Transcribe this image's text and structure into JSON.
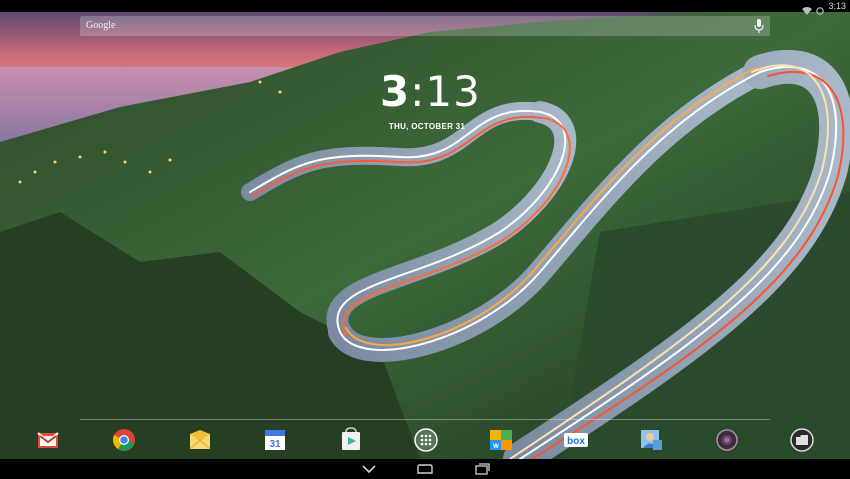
{
  "status_bar": {
    "time": "3:13",
    "icons": [
      "wifi-icon",
      "battery-icon"
    ]
  },
  "search": {
    "logo": "Google",
    "voice_icon": "microphone-icon"
  },
  "clock": {
    "hour": "3",
    "minute": "13",
    "date": "THU, OCTOBER 31"
  },
  "dock": {
    "apps": [
      {
        "name": "Gmail",
        "icon": "gmail-icon"
      },
      {
        "name": "Chrome",
        "icon": "chrome-icon"
      },
      {
        "name": "Email",
        "icon": "email-icon"
      },
      {
        "name": "Calendar",
        "icon": "calendar-icon",
        "badge": "31"
      },
      {
        "name": "Play Store",
        "icon": "play-store-icon"
      },
      {
        "name": "All Apps",
        "icon": "app-drawer-icon"
      },
      {
        "name": "Office Suite",
        "icon": "office-suite-icon"
      },
      {
        "name": "Box",
        "icon": "box-icon",
        "badge": "box"
      },
      {
        "name": "People",
        "icon": "contacts-icon"
      },
      {
        "name": "Camera",
        "icon": "camera-icon"
      },
      {
        "name": "File Manager",
        "icon": "file-manager-icon"
      }
    ]
  },
  "nav_bar": {
    "buttons": [
      "back-icon",
      "home-icon",
      "recents-icon"
    ]
  },
  "colors": {
    "status_bar_bg": "#000000",
    "text": "#ffffff",
    "search_bg": "rgba(255,255,255,0.22)"
  }
}
